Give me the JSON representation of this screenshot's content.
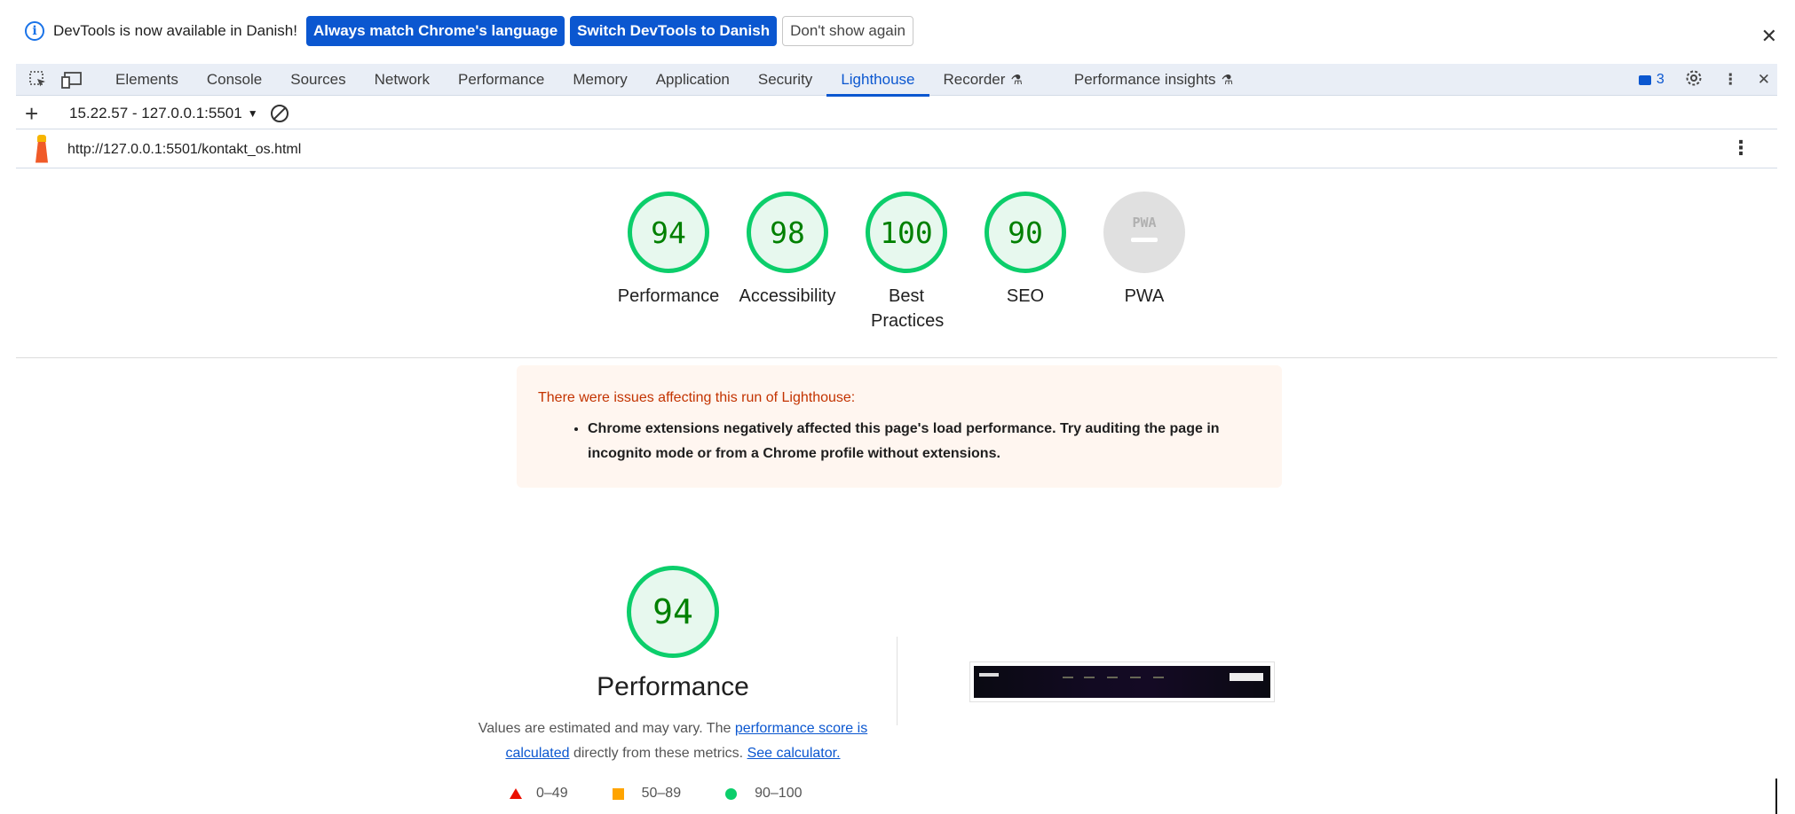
{
  "infobar": {
    "message": "DevTools is now available in Danish!",
    "btn_always_match": "Always match Chrome's language",
    "btn_switch": "Switch DevTools to Danish",
    "btn_dont_show": "Don't show again",
    "close": "✕"
  },
  "tabs": [
    {
      "label": "Elements"
    },
    {
      "label": "Console"
    },
    {
      "label": "Sources"
    },
    {
      "label": "Network"
    },
    {
      "label": "Performance"
    },
    {
      "label": "Memory"
    },
    {
      "label": "Application"
    },
    {
      "label": "Security"
    },
    {
      "label": "Lighthouse",
      "active": true
    },
    {
      "label": "Recorder"
    },
    {
      "label": "Performance insights"
    }
  ],
  "toolbar_right": {
    "issues_count": "3"
  },
  "lighthouse_toolbar": {
    "run_selector": "15.22.57 - 127.0.0.1:5501"
  },
  "url": "http://127.0.0.1:5501/kontakt_os.html",
  "gauges": [
    {
      "score": "94",
      "label": "Performance"
    },
    {
      "score": "98",
      "label": "Accessibility"
    },
    {
      "score": "100",
      "label": "Best Practices"
    },
    {
      "score": "90",
      "label": "SEO"
    },
    {
      "score": "PWA",
      "label": "PWA"
    }
  ],
  "warning": {
    "title": "There were issues affecting this run of Lighthouse:",
    "item": "Chrome extensions negatively affected this page's load performance. Try auditing the page in incognito mode or from a Chrome profile without extensions."
  },
  "performance": {
    "score": "94",
    "title": "Performance",
    "desc_prefix": "Values are estimated and may vary. The ",
    "link_score": "performance score is calculated",
    "desc_mid": " directly from these metrics. ",
    "link_calc": "See calculator.",
    "legend": {
      "fail": "0–49",
      "average": "50–89",
      "pass": "90–100"
    }
  },
  "colors": {
    "accent": "#0b57d0",
    "pass": "#0cce6b",
    "average": "#ffa400",
    "fail": "#eb0f00"
  }
}
